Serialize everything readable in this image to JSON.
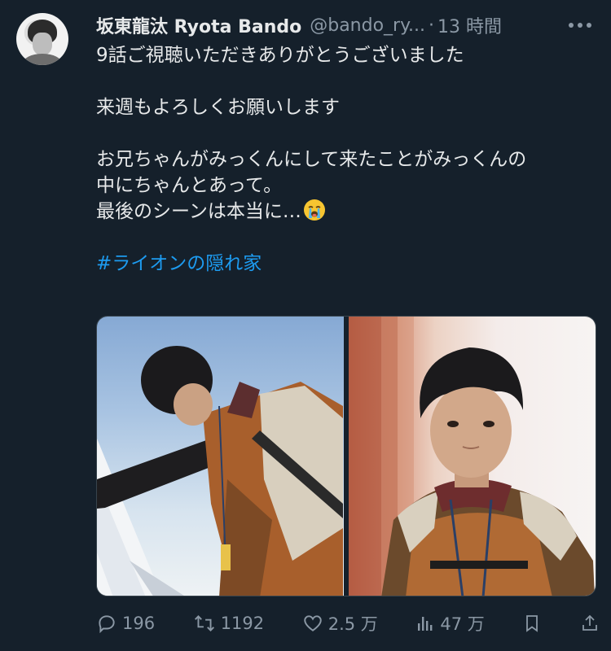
{
  "author": {
    "display_name": "坂東龍汰 Ryota Bando",
    "handle": "@bando_ry...",
    "separator": "·",
    "time_ago": "13 時間"
  },
  "tweet": {
    "lines": [
      "9話ご視聴いただきありがとうございました",
      "",
      "来週もよろしくお願いします",
      "",
      "お兄ちゃんがみっくんにして来たことがみっくんの",
      "中にちゃんとあって。",
      "最後のシーンは本当に…"
    ],
    "emoji": "crying-face-emoji",
    "hashtag": "#ライオンの隠れ家"
  },
  "media": {
    "count": 2
  },
  "actions": {
    "replies": "196",
    "retweets": "1192",
    "likes": "2.5 万",
    "views": "47 万"
  },
  "icons": {
    "more": "more-horizontal-icon",
    "reply": "reply-icon",
    "retweet": "retweet-icon",
    "like": "heart-icon",
    "views": "views-chart-icon",
    "bookmark": "bookmark-icon",
    "share": "share-icon"
  },
  "colors": {
    "background": "#15202b",
    "text": "#e7e9ea",
    "muted": "#8b98a5",
    "link": "#1d9bf0"
  }
}
